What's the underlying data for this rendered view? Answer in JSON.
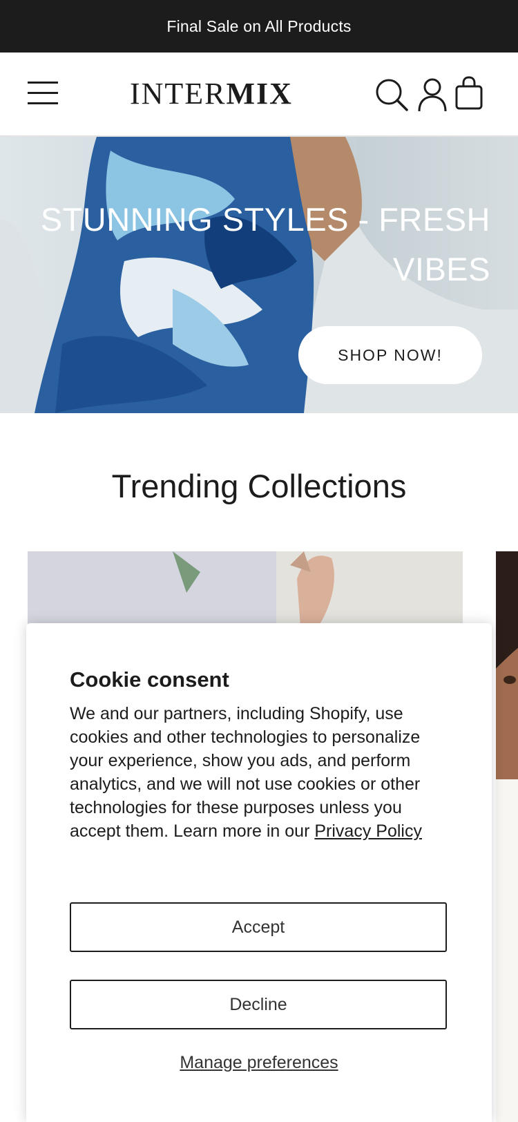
{
  "announcement": {
    "text": "Final Sale on All Products"
  },
  "header": {
    "logo_thin": "INTER",
    "logo_bold": "MIX",
    "icons": {
      "menu": "hamburger-icon",
      "search": "search-icon",
      "account": "user-icon",
      "cart": "shopping-bag-icon"
    }
  },
  "hero": {
    "headline": "STUNNING STYLES - FRESH VIBES",
    "cta_label": "SHOP NOW!"
  },
  "trending": {
    "title": "Trending Collections"
  },
  "cookie": {
    "title": "Cookie consent",
    "body": "We and our partners, including Shopify, use cookies and other technologies to personalize your experience, show you ads, and perform analytics, and we will not use cookies or other technologies for these purposes unless you accept them. Learn more in our ",
    "policy_link": "Privacy Policy",
    "accept_label": "Accept",
    "decline_label": "Decline",
    "manage_label": "Manage preferences"
  },
  "colors": {
    "announcement_bg": "#1c1c1c",
    "text": "#1c1c1c",
    "white": "#ffffff"
  }
}
